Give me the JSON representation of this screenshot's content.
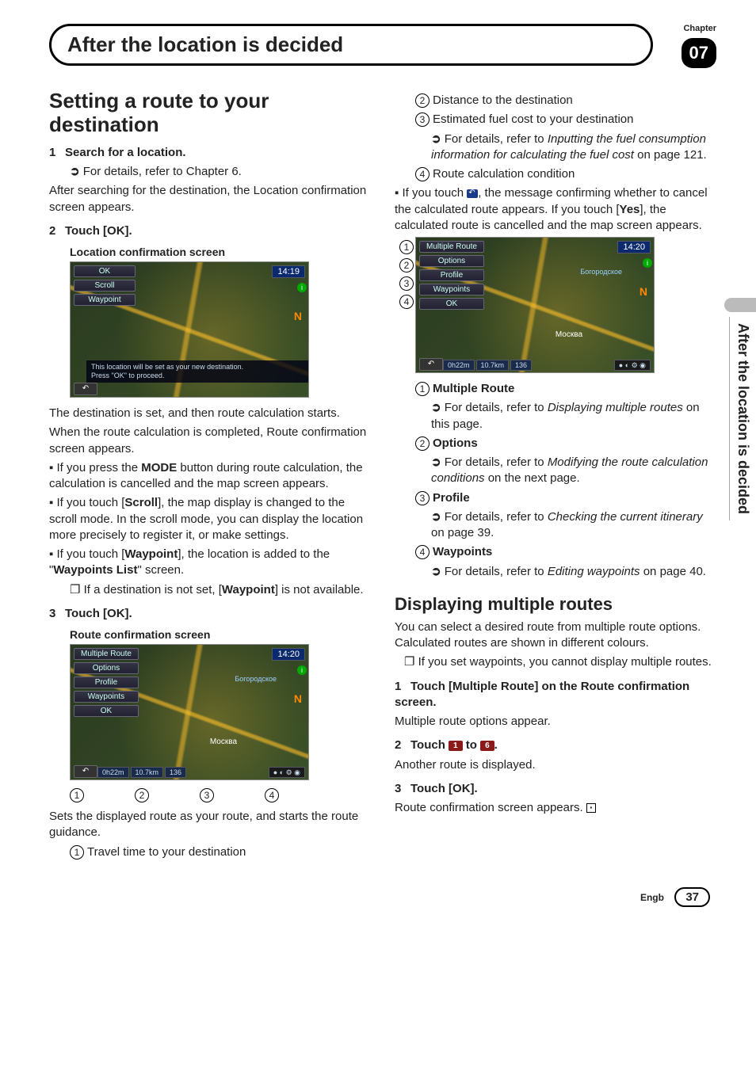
{
  "chapter": {
    "label": "Chapter",
    "number": "07"
  },
  "title": "After the location is decided",
  "sideTab": "After the location is decided",
  "left": {
    "h1": "Setting a route to your destination",
    "step1": {
      "num": "1",
      "label": "Search for a location."
    },
    "step1_detail": "For details, refer to Chapter 6.",
    "step1_after": "After searching for the destination, the Location confirmation screen appears.",
    "step2": {
      "num": "2",
      "label": "Touch [OK]."
    },
    "caption1": "Location confirmation screen",
    "shot1": {
      "time": "14:19",
      "buttons": [
        "OK",
        "Scroll",
        "Waypoint"
      ],
      "msg1": "This location will be set as your new destination.",
      "msg2": "Press \"OK\" to proceed.",
      "compass": "N"
    },
    "p1": "The destination is set, and then route calculation starts.",
    "p2": "When the route calculation is completed, Route confirmation screen appears.",
    "b1a": "If you press the ",
    "b1b": "MODE",
    "b1c": " button during route calculation, the calculation is cancelled and the map screen appears.",
    "b2a": "If you touch [",
    "b2b": "Scroll",
    "b2c": "], the map display is changed to the scroll mode. In the scroll mode, you can display the location more precisely to register it, or make settings.",
    "b3a": "If you touch [",
    "b3b": "Waypoint",
    "b3c": "], the location is added to the \"",
    "b3d": "Waypoints List",
    "b3e": "\" screen.",
    "note1a": "If a destination is not set, [",
    "note1b": "Waypoint",
    "note1c": "] is not available.",
    "step3": {
      "num": "3",
      "label": "Touch [OK]."
    },
    "caption2": "Route confirmation screen",
    "shot2": {
      "time": "14:20",
      "buttons": [
        "Multiple Route",
        "Options",
        "Profile",
        "Waypoints",
        "OK"
      ],
      "compass": "N",
      "status": [
        "0h22m",
        "10.7km",
        "136"
      ],
      "label": "Богородское",
      "city": "Москва"
    },
    "callouts": [
      "1",
      "2",
      "3",
      "4"
    ],
    "p3": "Sets the displayed route as your route, and starts the route guidance.",
    "c1": "Travel time to your destination"
  },
  "right": {
    "c2": "Distance to the destination",
    "c3": "Estimated fuel cost to your destination",
    "c3_detail_a": "For details, refer to ",
    "c3_detail_b": "Inputting the fuel consumption information for calculating the fuel cost",
    "c3_detail_c": " on page 121.",
    "c4": "Route calculation condition",
    "b4a": "If you touch ",
    "b4b": ", the message confirming whether to cancel the calculated route appears. If you touch [",
    "b4c": "Yes",
    "b4d": "], the calculated route is cancelled and the map screen appears.",
    "shot3": {
      "time": "14:20",
      "buttons": [
        "Multiple Route",
        "Options",
        "Profile",
        "Waypoints",
        "OK"
      ],
      "compass": "N",
      "status": [
        "0h22m",
        "10.7km",
        "136"
      ],
      "label": "Богородское",
      "city": "Москва"
    },
    "side_callouts": [
      "1",
      "2",
      "3",
      "4"
    ],
    "d1": {
      "t": "Multiple Route",
      "a": "For details, refer to ",
      "b": "Displaying multiple routes",
      "c": " on this page."
    },
    "d2": {
      "t": "Options",
      "a": "For details, refer to ",
      "b": "Modifying the route calculation conditions",
      "c": " on the next page."
    },
    "d3": {
      "t": "Profile",
      "a": "For details, refer to ",
      "b": "Checking the current itinerary",
      "c": " on page 39."
    },
    "d4": {
      "t": "Waypoints",
      "a": "For details, refer to ",
      "b": "Editing waypoints",
      "c": " on page 40."
    },
    "h2": "Displaying multiple routes",
    "p4": "You can select a desired route from multiple route options. Calculated routes are shown in different colours.",
    "note2": "If you set waypoints, you cannot display multiple routes.",
    "s1": {
      "num": "1",
      "label": "Touch [Multiple Route] on the Route confirmation screen."
    },
    "s1_after": "Multiple route options appear.",
    "s2": {
      "num": "2",
      "a": "Touch ",
      "b1": "1",
      "mid": " to ",
      "b2": "6",
      "end": "."
    },
    "s2_after": "Another route is displayed.",
    "s3": {
      "num": "3",
      "label": "Touch [OK]."
    },
    "s3_after": "Route confirmation screen appears."
  },
  "footer": {
    "lang": "Engb",
    "page": "37"
  }
}
